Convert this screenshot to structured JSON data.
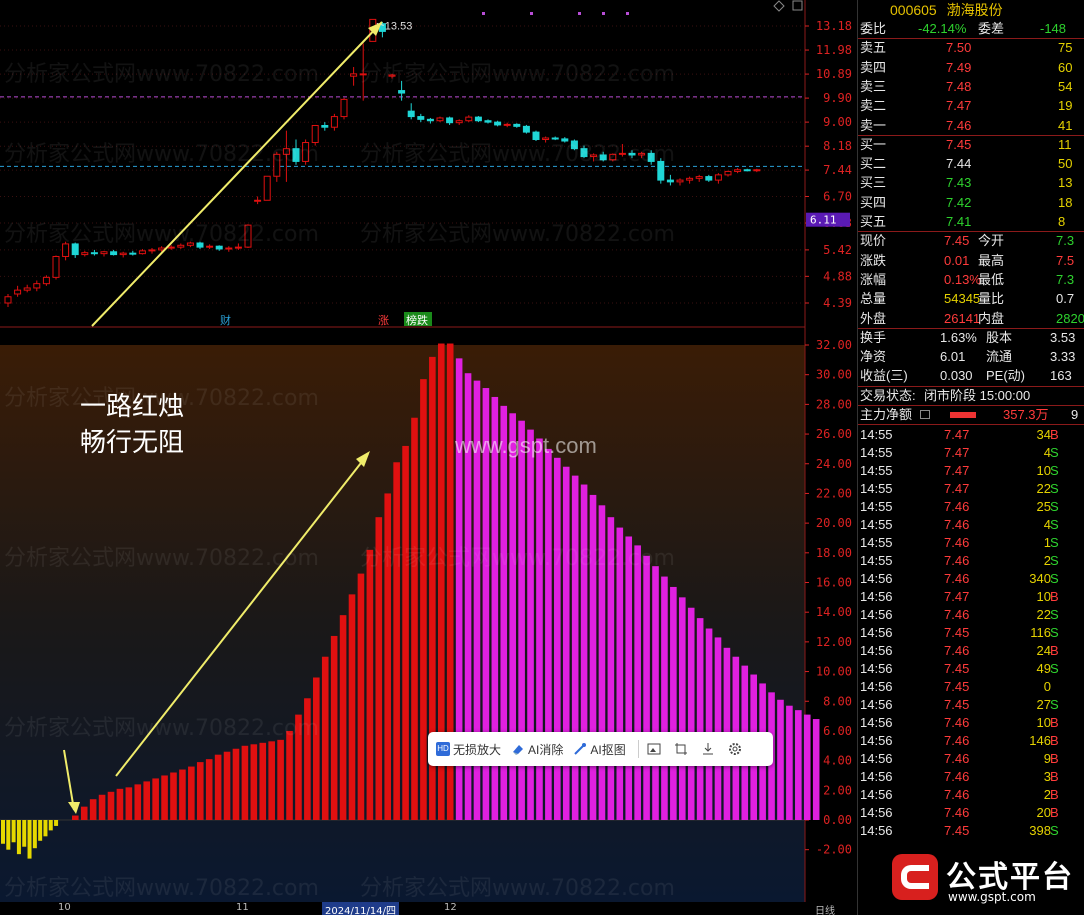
{
  "stock": {
    "code": "000605",
    "name": "渤海股份"
  },
  "kline": {
    "price_axis": [
      "13.18",
      "11.98",
      "10.89",
      "9.90",
      "9.00",
      "8.18",
      "7.44",
      "6.70",
      "6.03",
      "5.42",
      "4.88",
      "4.39"
    ],
    "current_price_tag": "6.11",
    "peak_label": "13.53",
    "markers": [
      {
        "text": "财"
      },
      {
        "text": "涨"
      },
      {
        "text": "榜跌"
      }
    ]
  },
  "indicator": {
    "axis": [
      "32.00",
      "30.00",
      "28.00",
      "26.00",
      "24.00",
      "22.00",
      "20.00",
      "18.00",
      "16.00",
      "14.00",
      "12.00",
      "10.00",
      "8.00",
      "6.00",
      "4.00",
      "2.00",
      "0.00",
      "-2.00"
    ],
    "annotation_line1": "一路红烛",
    "annotation_line2": "畅行无阻",
    "site_mark": "www.gspt.com"
  },
  "chart_data": {
    "type": "bar",
    "title": "",
    "ylim": [
      -3,
      32
    ],
    "pre_values": [
      -1.6,
      -2.0,
      -1.5,
      -2.3,
      -1.8,
      -2.6,
      -1.9,
      -1.4,
      -1.1,
      -0.7,
      -0.4
    ],
    "values": [
      0.3,
      0.9,
      1.4,
      1.7,
      1.9,
      2.1,
      2.2,
      2.4,
      2.6,
      2.8,
      3.0,
      3.2,
      3.4,
      3.6,
      3.9,
      4.1,
      4.4,
      4.6,
      4.8,
      5.0,
      5.1,
      5.2,
      5.3,
      5.4,
      6.0,
      7.1,
      8.2,
      9.6,
      11.0,
      12.4,
      13.8,
      15.2,
      16.6,
      18.2,
      20.4,
      22.0,
      24.1,
      25.2,
      27.1,
      29.7,
      31.2,
      32.1,
      32.1,
      31.1,
      30.1,
      29.6,
      29.1,
      28.5,
      27.9,
      27.4,
      26.9,
      26.3,
      25.7,
      25.0,
      24.4,
      23.8,
      23.2,
      22.6,
      21.9,
      21.2,
      20.4,
      19.7,
      19.1,
      18.5,
      17.8,
      17.1,
      16.4,
      15.7,
      15.0,
      14.3,
      13.6,
      12.9,
      12.3,
      11.6,
      11.0,
      10.4,
      9.8,
      9.2,
      8.6,
      8.1,
      7.7,
      7.4,
      7.1,
      6.8
    ],
    "colors": {
      "negative": "#e6d800",
      "rising": "#e01010",
      "falling": "#e020e0"
    },
    "peak_index": 42
  },
  "candles": [
    [
      4.39,
      4.55,
      4.32,
      4.5
    ],
    [
      4.55,
      4.7,
      4.5,
      4.62
    ],
    [
      4.62,
      4.72,
      4.58,
      4.66
    ],
    [
      4.66,
      4.8,
      4.6,
      4.74
    ],
    [
      4.74,
      4.9,
      4.7,
      4.86
    ],
    [
      4.86,
      5.3,
      4.82,
      5.28
    ],
    [
      5.28,
      5.6,
      5.2,
      5.55
    ],
    [
      5.55,
      5.58,
      5.25,
      5.32
    ],
    [
      5.32,
      5.4,
      5.28,
      5.36
    ],
    [
      5.36,
      5.42,
      5.3,
      5.34
    ],
    [
      5.34,
      5.4,
      5.28,
      5.38
    ],
    [
      5.38,
      5.42,
      5.3,
      5.32
    ],
    [
      5.32,
      5.38,
      5.26,
      5.35
    ],
    [
      5.35,
      5.4,
      5.3,
      5.34
    ],
    [
      5.34,
      5.44,
      5.32,
      5.4
    ],
    [
      5.4,
      5.46,
      5.34,
      5.42
    ],
    [
      5.42,
      5.5,
      5.38,
      5.46
    ],
    [
      5.46,
      5.52,
      5.42,
      5.48
    ],
    [
      5.48,
      5.56,
      5.44,
      5.52
    ],
    [
      5.52,
      5.6,
      5.48,
      5.57
    ],
    [
      5.57,
      5.6,
      5.44,
      5.48
    ],
    [
      5.48,
      5.54,
      5.44,
      5.5
    ],
    [
      5.5,
      5.52,
      5.4,
      5.44
    ],
    [
      5.44,
      5.5,
      5.38,
      5.46
    ],
    [
      5.46,
      5.56,
      5.42,
      5.48
    ],
    [
      5.48,
      6.0,
      5.46,
      5.98
    ],
    [
      6.6,
      6.7,
      6.5,
      6.6
    ],
    [
      6.6,
      7.26,
      6.6,
      7.26
    ],
    [
      7.26,
      8.0,
      7.1,
      7.92
    ],
    [
      7.92,
      8.7,
      7.1,
      8.1
    ],
    [
      8.1,
      8.4,
      7.6,
      7.7
    ],
    [
      7.7,
      8.4,
      7.6,
      8.3
    ],
    [
      8.3,
      8.9,
      8.2,
      8.88
    ],
    [
      8.88,
      9.0,
      8.7,
      8.82
    ],
    [
      8.82,
      9.3,
      8.7,
      9.2
    ],
    [
      9.2,
      9.9,
      9.1,
      9.85
    ],
    [
      10.8,
      11.2,
      10.4,
      10.9
    ],
    [
      10.9,
      12.3,
      9.8,
      10.9
    ],
    [
      12.4,
      13.53,
      12.4,
      13.53
    ],
    [
      13.3,
      13.4,
      12.6,
      12.9
    ],
    [
      10.8,
      10.9,
      10.7,
      10.85
    ],
    [
      10.2,
      10.6,
      9.8,
      10.1
    ],
    [
      9.4,
      9.7,
      9.1,
      9.2
    ],
    [
      9.2,
      9.3,
      9.0,
      9.1
    ],
    [
      9.1,
      9.15,
      8.95,
      9.05
    ],
    [
      9.05,
      9.2,
      9.0,
      9.15
    ],
    [
      9.15,
      9.2,
      8.9,
      8.98
    ],
    [
      8.98,
      9.1,
      8.9,
      9.05
    ],
    [
      9.05,
      9.25,
      9.0,
      9.18
    ],
    [
      9.18,
      9.22,
      9.0,
      9.05
    ],
    [
      9.05,
      9.1,
      8.95,
      9.0
    ],
    [
      9.0,
      9.05,
      8.85,
      8.9
    ],
    [
      8.9,
      8.98,
      8.82,
      8.92
    ],
    [
      8.92,
      8.96,
      8.8,
      8.85
    ],
    [
      8.85,
      8.9,
      8.6,
      8.65
    ],
    [
      8.65,
      8.7,
      8.35,
      8.4
    ],
    [
      8.4,
      8.5,
      8.3,
      8.45
    ],
    [
      8.45,
      8.5,
      8.38,
      8.42
    ],
    [
      8.42,
      8.48,
      8.3,
      8.35
    ],
    [
      8.35,
      8.4,
      8.05,
      8.1
    ],
    [
      8.1,
      8.2,
      7.8,
      7.85
    ],
    [
      7.85,
      7.95,
      7.7,
      7.9
    ],
    [
      7.9,
      8.0,
      7.7,
      7.75
    ],
    [
      7.75,
      7.95,
      7.7,
      7.92
    ],
    [
      7.92,
      8.25,
      7.85,
      7.95
    ],
    [
      7.95,
      8.05,
      7.8,
      7.9
    ],
    [
      7.9,
      8.0,
      7.8,
      7.95
    ],
    [
      7.95,
      8.05,
      7.6,
      7.7
    ],
    [
      7.7,
      7.8,
      7.05,
      7.15
    ],
    [
      7.15,
      7.3,
      7.0,
      7.1
    ],
    [
      7.1,
      7.2,
      7.0,
      7.15
    ],
    [
      7.15,
      7.25,
      7.05,
      7.2
    ],
    [
      7.2,
      7.3,
      7.1,
      7.25
    ],
    [
      7.25,
      7.3,
      7.1,
      7.15
    ],
    [
      7.15,
      7.35,
      7.05,
      7.3
    ],
    [
      7.3,
      7.42,
      7.25,
      7.4
    ],
    [
      7.4,
      7.5,
      7.35,
      7.45
    ],
    [
      7.45,
      7.48,
      7.4,
      7.42
    ],
    [
      7.42,
      7.48,
      7.38,
      7.45
    ]
  ],
  "quote": {
    "weibi_label": "委比",
    "weibi_value": "-42.14%",
    "weicha_label": "委差",
    "weicha_value": "-148",
    "asks": [
      {
        "label": "卖五",
        "price": "7.50",
        "vol": "75"
      },
      {
        "label": "卖四",
        "price": "7.49",
        "vol": "60"
      },
      {
        "label": "卖三",
        "price": "7.48",
        "vol": "54"
      },
      {
        "label": "卖二",
        "price": "7.47",
        "vol": "19"
      },
      {
        "label": "卖一",
        "price": "7.46",
        "vol": "41"
      }
    ],
    "bids": [
      {
        "label": "买一",
        "price": "7.45",
        "vol": "11"
      },
      {
        "label": "买二",
        "price": "7.44",
        "vol": "50"
      },
      {
        "label": "买三",
        "price": "7.43",
        "vol": "13"
      },
      {
        "label": "买四",
        "price": "7.42",
        "vol": "18"
      },
      {
        "label": "买五",
        "price": "7.41",
        "vol": "8"
      }
    ],
    "stats": [
      {
        "l1": "现价",
        "v1": "7.45",
        "l2": "今开",
        "v2": "7.3"
      },
      {
        "l1": "涨跌",
        "v1": "0.01",
        "l2": "最高",
        "v2": "7.5"
      },
      {
        "l1": "涨幅",
        "v1": "0.13%",
        "l2": "最低",
        "v2": "7.3"
      },
      {
        "l1": "总量",
        "v1": "54345",
        "l2": "量比",
        "v2": "0.7"
      },
      {
        "l1": "外盘",
        "v1": "26141",
        "l2": "内盘",
        "v2": "2820"
      }
    ],
    "stats2": [
      {
        "l1": "换手",
        "v1": "1.63%",
        "l2": "股本",
        "v2": "3.53"
      },
      {
        "l1": "净资",
        "v1": "6.01",
        "l2": "流通",
        "v2": "3.33"
      },
      {
        "l1": "收益(三)",
        "v1": "0.030",
        "l2": "PE(动)",
        "v2": "163"
      }
    ],
    "trade_status_label": "交易状态:",
    "trade_status_value": "闭市阶段 15:00:00",
    "main_flow_label": "主力净额",
    "main_flow_value": "357.3万",
    "main_flow_extra": "9"
  },
  "ticks": [
    {
      "t": "14:55",
      "p": "7.47",
      "v": "34",
      "s": "B"
    },
    {
      "t": "14:55",
      "p": "7.47",
      "v": "4",
      "s": "S"
    },
    {
      "t": "14:55",
      "p": "7.47",
      "v": "10",
      "s": "S"
    },
    {
      "t": "14:55",
      "p": "7.47",
      "v": "22",
      "s": "S"
    },
    {
      "t": "14:55",
      "p": "7.46",
      "v": "25",
      "s": "S"
    },
    {
      "t": "14:55",
      "p": "7.46",
      "v": "4",
      "s": "S"
    },
    {
      "t": "14:55",
      "p": "7.46",
      "v": "1",
      "s": "S"
    },
    {
      "t": "14:55",
      "p": "7.46",
      "v": "2",
      "s": "S"
    },
    {
      "t": "14:56",
      "p": "7.46",
      "v": "340",
      "s": "S"
    },
    {
      "t": "14:56",
      "p": "7.47",
      "v": "10",
      "s": "B"
    },
    {
      "t": "14:56",
      "p": "7.46",
      "v": "22",
      "s": "S"
    },
    {
      "t": "14:56",
      "p": "7.45",
      "v": "116",
      "s": "S"
    },
    {
      "t": "14:56",
      "p": "7.46",
      "v": "24",
      "s": "B"
    },
    {
      "t": "14:56",
      "p": "7.45",
      "v": "49",
      "s": "S"
    },
    {
      "t": "14:56",
      "p": "7.45",
      "v": "0",
      "s": ""
    },
    {
      "t": "14:56",
      "p": "7.45",
      "v": "27",
      "s": "S"
    },
    {
      "t": "14:56",
      "p": "7.46",
      "v": "10",
      "s": "B"
    },
    {
      "t": "14:56",
      "p": "7.46",
      "v": "146",
      "s": "B"
    },
    {
      "t": "14:56",
      "p": "7.46",
      "v": "9",
      "s": "B"
    },
    {
      "t": "14:56",
      "p": "7.46",
      "v": "3",
      "s": "B"
    },
    {
      "t": "14:56",
      "p": "7.46",
      "v": "2",
      "s": "B"
    },
    {
      "t": "14:56",
      "p": "7.46",
      "v": "20",
      "s": "B"
    },
    {
      "t": "14:56",
      "p": "7.45",
      "v": "398",
      "s": "S"
    }
  ],
  "toolbar": {
    "lossless_zoom": "无损放大",
    "ai_erase": "AI消除",
    "ai_cutout": "AI抠图"
  },
  "bottom_axis": {
    "d1": "10",
    "d2": "11",
    "d3": "2024/11/14/四",
    "d4": "12",
    "d5": "日线"
  },
  "logo": {
    "title": "公式平台",
    "url": "www.gspt.com"
  },
  "watermark_text": "分析家公式网www.70822.com",
  "colors": {
    "up": "#e01010",
    "down": "#1fd6d6",
    "axis": "#d22",
    "accent": "#e5c100"
  }
}
